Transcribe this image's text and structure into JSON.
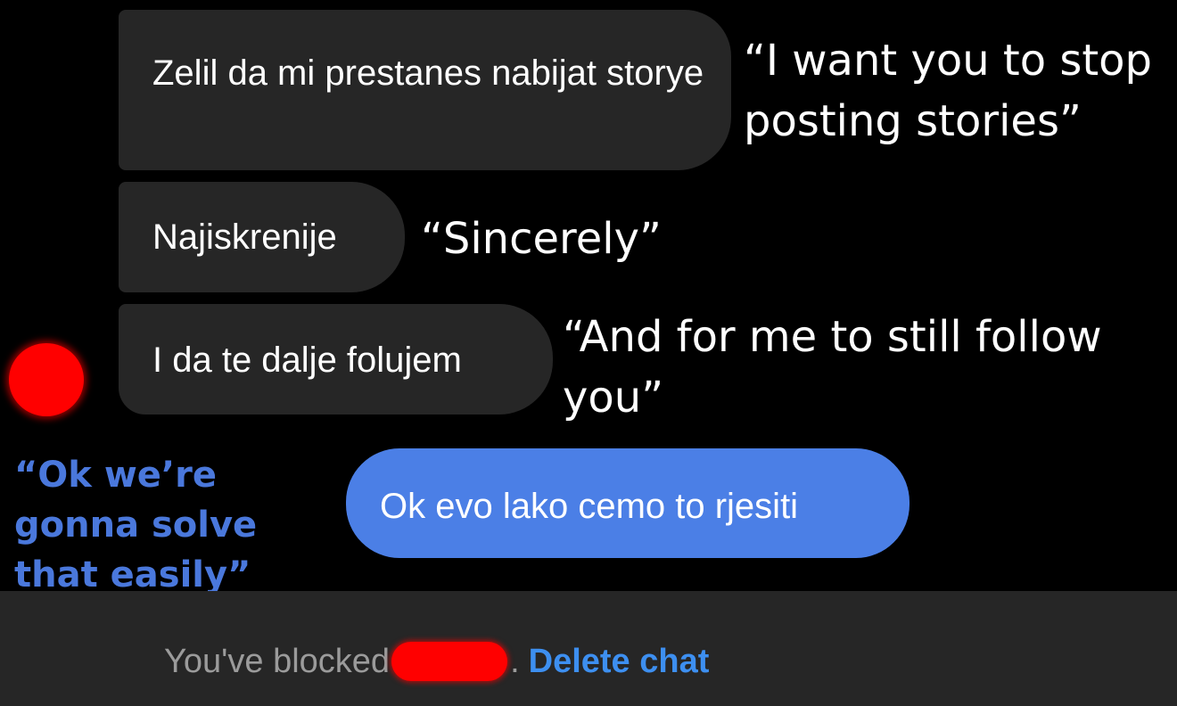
{
  "messages": [
    {
      "text": "Zelil da mi prestanes nabijat storye",
      "translation": "“I want you to stop posting stories”"
    },
    {
      "text": "Najiskrenije",
      "translation": "“Sincerely”"
    },
    {
      "text": "I da te dalje folujem",
      "translation": "“And for me to still follow you”"
    }
  ],
  "reply": {
    "text": "Ok evo lako cemo to rjesiti",
    "translation": "“Ok we’re gonna solve that easily”"
  },
  "footer": {
    "blocked_text": "You've blocked",
    "suffix": ".",
    "delete_label": "Delete chat"
  },
  "colors": {
    "background": "#000000",
    "bubble_received": "#262626",
    "bubble_sent": "#4b7fe6",
    "link": "#3d8ff0",
    "translation_blue": "#4a78dc",
    "redaction": "#ff0000"
  }
}
